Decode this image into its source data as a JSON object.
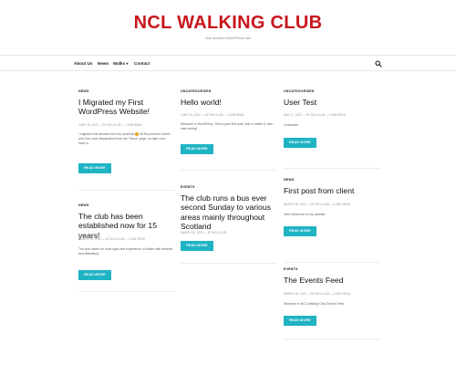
{
  "site": {
    "title": "NCL WALKING CLUB",
    "tagline": "Just another WordPress site"
  },
  "nav": {
    "items": [
      "About Us",
      "News",
      "Walks",
      "Contact"
    ],
    "walks_caret": "▾",
    "search_icon": "search-icon"
  },
  "posts": [
    {
      "category": "NEWS",
      "title": "I Migrated my First WordPress Website!",
      "meta": "JUNE 30, 2022  —  BY NCLCLUB  —  1 MIN READ",
      "excerpt_before": "I migrated this website from my localhost ",
      "excerpt_after": " All the previous Admin and User post dissapeared from the \"News\" page, so right now I have to",
      "button": "READ MORE"
    },
    {
      "category": "NEWS",
      "title": "The club has been established now for 15 years!",
      "meta": "MARCH 26, 2022  —  BY NCLCLUB  —  1 MIN READ",
      "excerpt": "The club caters for most ages and experience of walker with rambles and hillwalking.",
      "button": "READ MORE"
    },
    {
      "category": "UNCATEGORIZED",
      "title": "Hello world!",
      "meta": "JUNE 30, 2022  —  BY NCLCLUB  —  1 MIN READ",
      "excerpt": "Welcome to WordPress. This is your first post. Edit or delete it, then start writing!",
      "button": "READ MORE"
    },
    {
      "category": "EVENTS",
      "title": "The club runs a bus ever second Sunday to various areas mainly throughout Scotland",
      "meta": "MARCH 26, 2022  —  BY NCLCLUB",
      "button": "READ MORE"
    },
    {
      "category": "UNCATEGORIZED",
      "title": "User Test",
      "meta": "MAY 27, 2022  —  BY NCLCLUB  —  1 MIN READ",
      "excerpt": "Customize",
      "button": "READ MORE"
    },
    {
      "category": "NEWS",
      "title": "First post from client",
      "meta": "MARCH 26, 2022  —  BY NCLCLUB  —  1 MIN READ",
      "excerpt": "Hello Welcome on my website",
      "button": "READ MORE"
    },
    {
      "category": "EVENTS",
      "title": "The Events Feed",
      "meta": "MARCH 26, 2022  —  BY NCLCLUB  —  1 MIN READ",
      "excerpt": "Welcome to NCL Walking Club Events Feed",
      "button": "READ MORE"
    }
  ]
}
